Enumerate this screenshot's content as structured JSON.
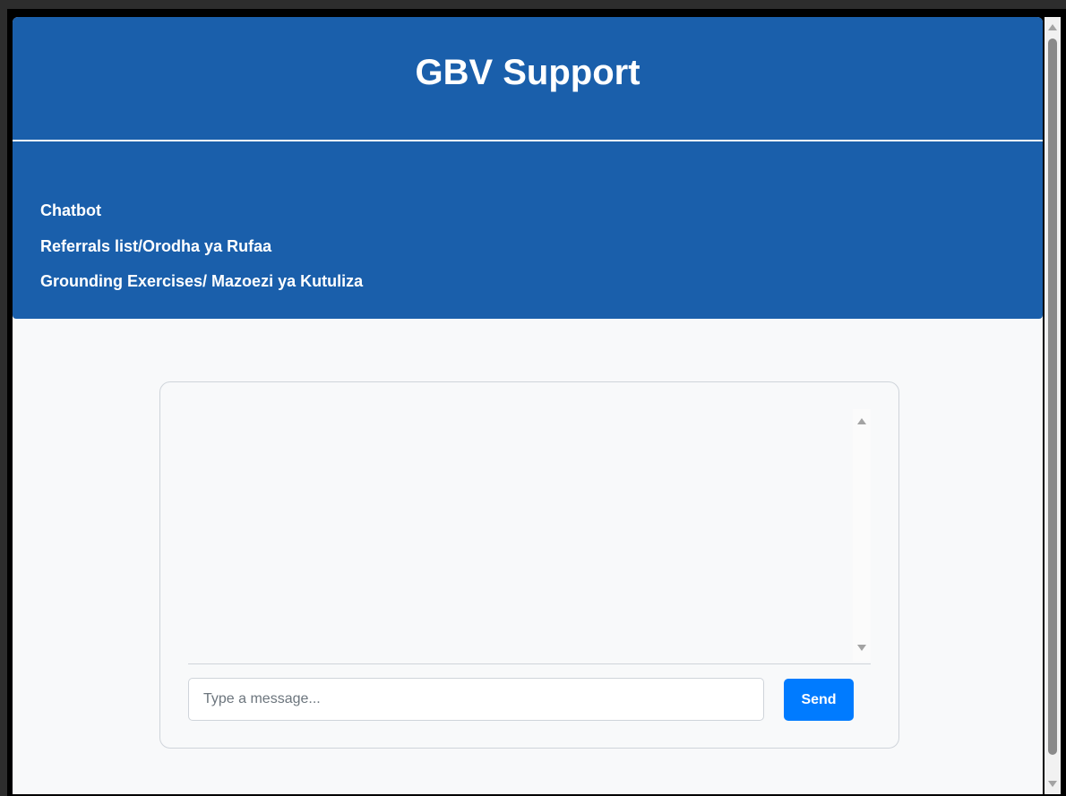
{
  "header": {
    "title": "GBV Support"
  },
  "nav": {
    "items": [
      {
        "label": "Chatbot"
      },
      {
        "label": "Referrals list/Orodha ya Rufaa"
      },
      {
        "label": "Grounding Exercises/ Mazoezi ya Kutuliza"
      }
    ]
  },
  "chat": {
    "input_value": "",
    "input_placeholder": "Type a message...",
    "send_label": "Send"
  },
  "colors": {
    "header_bg": "#1a5fab",
    "send_button": "#007bff",
    "page_bg": "#f8f9fa"
  },
  "icons": {
    "scroll_up": "chevron-up-icon",
    "scroll_down": "chevron-down-icon"
  }
}
